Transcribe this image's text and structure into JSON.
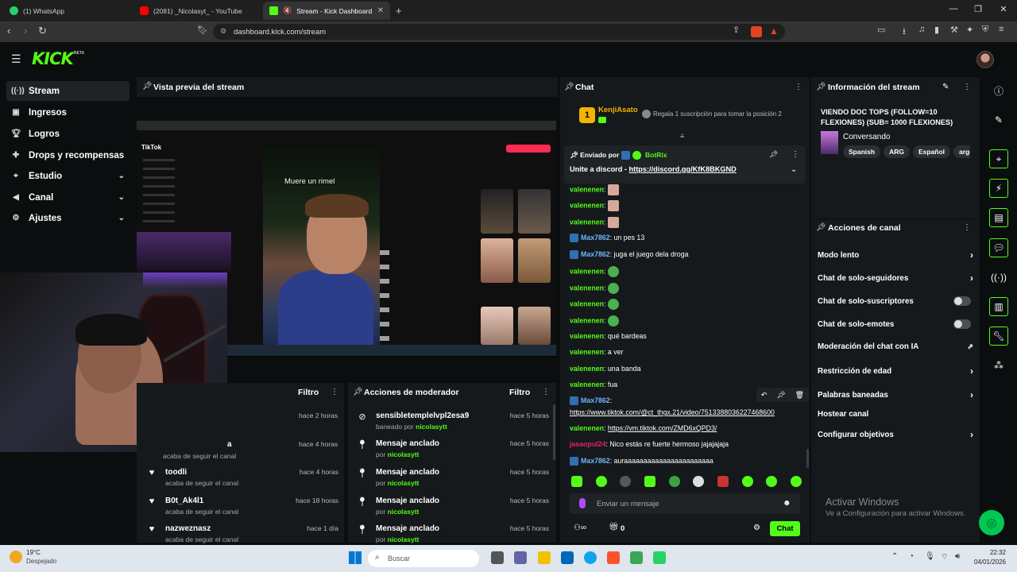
{
  "browser": {
    "tabs": [
      {
        "label": "(1) WhatsApp",
        "color": "#25d366"
      },
      {
        "label": "(2081) _Nicolasyt_ - YouTube",
        "color": "#ff0000"
      },
      {
        "label": "Stream - Kick Dashboard",
        "color": "#53fc18"
      }
    ],
    "url": "dashboard.kick.com/stream"
  },
  "header": {
    "logo": "KICK",
    "beta": "BETA"
  },
  "sidebar": {
    "items": [
      {
        "label": "Stream",
        "icon": "broadcast-icon"
      },
      {
        "label": "Ingresos",
        "icon": "wallet-icon"
      },
      {
        "label": "Logros",
        "icon": "trophy-icon"
      },
      {
        "label": "Drops y recompensas",
        "icon": "gift-icon"
      },
      {
        "label": "Estudio",
        "icon": "studio-icon"
      },
      {
        "label": "Canal",
        "icon": "channel-icon"
      },
      {
        "label": "Ajustes",
        "icon": "gear-icon"
      }
    ]
  },
  "preview": {
    "title": "Vista previa del stream",
    "caption": "Muere un rimel",
    "tiktok_logo": "TikTok"
  },
  "feed": {
    "filter_label": "Filtro",
    "items": [
      {
        "name": "",
        "sub": "",
        "time": "hace 2 horas"
      },
      {
        "name": "",
        "sub": "acaba de seguir el canal",
        "time": "hace 4 horas"
      },
      {
        "name": "toodli",
        "sub": "acaba de seguir el canal",
        "time": "hace 4 horas"
      },
      {
        "name": "B0t_Ak4l1",
        "sub": "acaba de seguir el canal",
        "time": "hace 18 horas"
      },
      {
        "name": "nazweznasz",
        "sub": "acaba de seguir el canal",
        "time": "hace 1 día"
      }
    ]
  },
  "mod_actions": {
    "title": "Acciones de moderador",
    "filter_label": "Filtro",
    "items": [
      {
        "name": "sensibletemplelvpl2esa9",
        "sub_prefix": "baneado por",
        "by": "nicolasytt",
        "time": "hace 5 horas"
      },
      {
        "name": "Mensaje anclado",
        "sub_prefix": "por",
        "by": "nicolasytt",
        "time": "hace 5 horas"
      },
      {
        "name": "Mensaje anclado",
        "sub_prefix": "por",
        "by": "nicolasytt",
        "time": "hace 5 horas"
      },
      {
        "name": "Mensaje anclado",
        "sub_prefix": "por",
        "by": "nicolasytt",
        "time": "hace 5 horas"
      },
      {
        "name": "Mensaje anclado",
        "sub_prefix": "por",
        "by": "nicolasytt",
        "time": "hace 5 horas"
      }
    ]
  },
  "chat": {
    "title": "Chat",
    "top_gifter": {
      "rank": "1",
      "name": "KenjiAsato",
      "promo": "Regala 1 suscripción para tomar la posición 2"
    },
    "pinned": {
      "prefix": "Enviado por",
      "author": "BotRix",
      "text": "Unite a discord - ",
      "link": "https://discord.gg/KfK8BKGND"
    },
    "messages": [
      {
        "user": "valenenen",
        "text": ":",
        "color": "#53fc18"
      },
      {
        "user": "valenenen",
        "text": ":",
        "color": "#53fc18"
      },
      {
        "user": "valenenen",
        "text": ":",
        "color": "#53fc18"
      },
      {
        "user": "Max7862",
        "text": ": un pes 13",
        "color": "#6fb5ff"
      },
      {
        "user": "Max7862",
        "text": ": juga el juego dela droga",
        "color": "#6fb5ff"
      },
      {
        "user": "valenenen",
        "text": ":",
        "color": "#53fc18"
      },
      {
        "user": "valenenen",
        "text": ":",
        "color": "#53fc18"
      },
      {
        "user": "valenenen",
        "text": ":",
        "color": "#53fc18"
      },
      {
        "user": "valenenen",
        "text": ":",
        "color": "#53fc18"
      },
      {
        "user": "valenenen",
        "text": ": qué bardeas",
        "color": "#53fc18"
      },
      {
        "user": "valenenen",
        "text": ": a ver",
        "color": "#53fc18"
      },
      {
        "user": "valenenen",
        "text": ": una banda",
        "color": "#53fc18"
      },
      {
        "user": "valenenen",
        "text": ": fua",
        "color": "#53fc18"
      }
    ],
    "max_link_user": "Max7862",
    "max_link1": "https://www.tiktok.com/@ct_thgx.21/video/7513388036227468600",
    "max_link2": "https://vm.tiktok.com/ZMD6xQPD3/",
    "later_messages": [
      {
        "user": "jasaopul24",
        "text": ": Nico estás re fuerte hermoso jajajajaja",
        "color": "#e0245e"
      },
      {
        "user": "Max7862",
        "text": ": auraaaaaaaaaaaaaaaaaaaaaaa",
        "color": "#6fb5ff"
      }
    ],
    "input_placeholder": "Enviar un mensaje",
    "points": "0",
    "send_label": "Chat"
  },
  "stream_info": {
    "title": "Información del stream",
    "stream_title": "VIENDO DOC TOPS (FOLLOW=10 FLEXIONES) (SUB= 1000 FLEXIONES)",
    "category": "Conversando",
    "tags": [
      "Spanish",
      "ARG",
      "Español",
      "argentin"
    ]
  },
  "channel_actions": {
    "title": "Acciones de canal",
    "items": [
      {
        "label": "Modo lento",
        "control": "chevron"
      },
      {
        "label": "Chat de solo-seguidores",
        "control": "chevron"
      },
      {
        "label": "Chat de solo-suscriptores",
        "control": "toggle"
      },
      {
        "label": "Chat de solo-emotes",
        "control": "toggle"
      },
      {
        "label": "Moderación del chat con IA",
        "control": "external"
      },
      {
        "label": "Restricción de edad",
        "control": "chevron"
      },
      {
        "label": "Palabras baneadas",
        "control": "chevron"
      },
      {
        "label": "Hostear canal",
        "control": "none"
      },
      {
        "label": "Configurar objetivos",
        "control": "chevron"
      }
    ]
  },
  "windows_watermark": {
    "title": "Activar Windows",
    "sub": "Ve a Configuración para activar Windows."
  },
  "taskbar": {
    "weather_temp": "19°C",
    "weather_desc": "Despejado",
    "search": "Buscar",
    "time": "22:32",
    "date": "04/01/2026"
  }
}
